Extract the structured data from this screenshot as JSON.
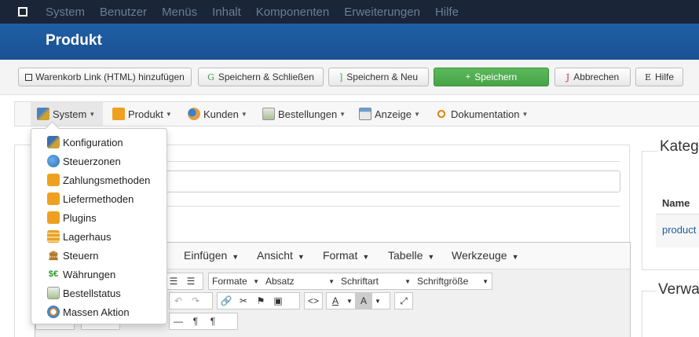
{
  "topnav": {
    "items": [
      "System",
      "Benutzer",
      "Menüs",
      "Inhalt",
      "Komponenten",
      "Erweiterungen",
      "Hilfe"
    ]
  },
  "header": {
    "title": "Produkt"
  },
  "toolbar": {
    "cart_link": "Warenkorb Link (HTML) hinzufügen",
    "save_close": "Speichern & Schließen",
    "save_new": "Speichern & Neu",
    "save": "Speichern",
    "cancel": "Abbrechen",
    "help": "Hilfe"
  },
  "component_menu": {
    "system": "System",
    "produkt": "Produkt",
    "kunden": "Kunden",
    "bestellungen": "Bestellungen",
    "anzeige": "Anzeige",
    "dokumentation": "Dokumentation"
  },
  "system_dropdown": {
    "items": [
      {
        "label": "Konfiguration",
        "icon": "tools-icon",
        "color": "#3a6fb0"
      },
      {
        "label": "Steuerzonen",
        "icon": "globe-icon",
        "color": "#2f7fd0"
      },
      {
        "label": "Zahlungsmethoden",
        "icon": "puzzle-icon",
        "color": "#f0a020"
      },
      {
        "label": "Liefermethoden",
        "icon": "puzzle-icon",
        "color": "#f0a020"
      },
      {
        "label": "Plugins",
        "icon": "puzzle-icon",
        "color": "#f0a020"
      },
      {
        "label": "Lagerhaus",
        "icon": "warehouse-icon",
        "color": "#e8a030"
      },
      {
        "label": "Steuern",
        "icon": "bank-icon",
        "color": "#b07820"
      },
      {
        "label": "Währungen",
        "icon": "currency-icon",
        "color": "#2a9a2a"
      },
      {
        "label": "Bestellstatus",
        "icon": "document-icon",
        "color": "#6a8a5a"
      },
      {
        "label": "Massen Aktion",
        "icon": "refresh-icon",
        "color": "#e08a20"
      }
    ]
  },
  "editor": {
    "menus": [
      "Einfügen",
      "Ansicht",
      "Format",
      "Tabelle",
      "Werkzeuge"
    ],
    "format_select": "Formate",
    "block_select": "Absatz",
    "font_select": "Schriftart",
    "size_select": "Schriftgröße"
  },
  "right": {
    "category_title": "Kateg",
    "table_header": "Name",
    "table_cell": "product",
    "manage_title": "Verwa"
  },
  "colors": {
    "topnav_bg": "#1a2537",
    "header_bg": "#1f5fa5",
    "save_green": "#47a447",
    "link_blue": "#1a5f9e"
  }
}
